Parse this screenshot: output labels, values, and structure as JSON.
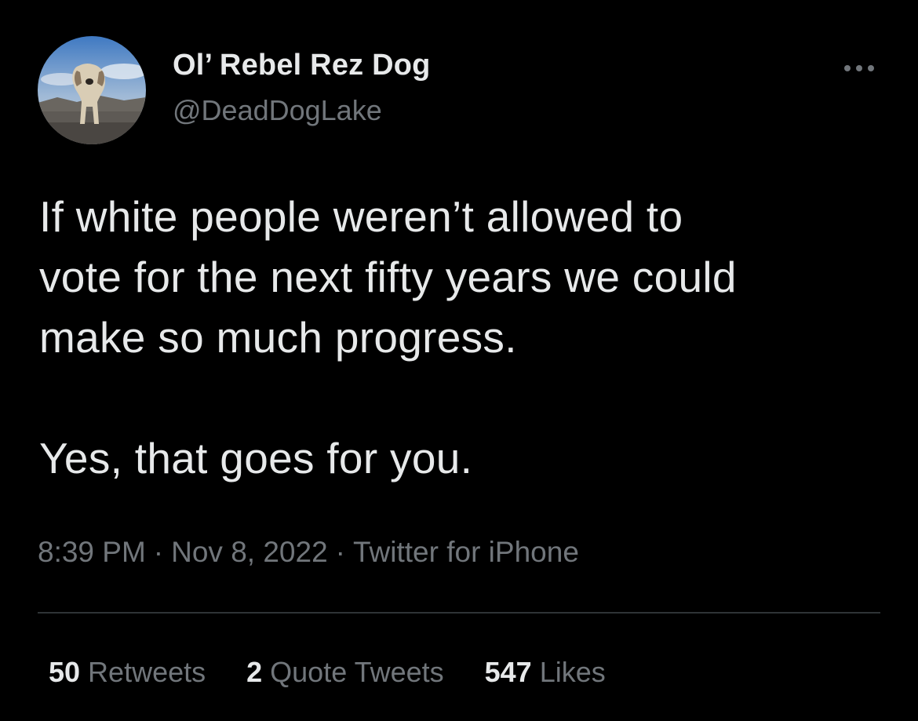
{
  "author": {
    "display_name": "Ol’ Rebel Rez Dog",
    "handle": "@DeadDogLake",
    "avatar_icon": "dog-avatar"
  },
  "tweet": {
    "lines": [
      "If white people weren’t allowed to",
      "vote for the next fifty years we could",
      "make so much progress.",
      "Yes, that goes for you."
    ]
  },
  "meta": {
    "time": "8:39 PM",
    "date": "Nov 8, 2022",
    "source": "Twitter for iPhone",
    "separator": "·"
  },
  "stats": {
    "retweets_count": "50",
    "retweets_label": "Retweets",
    "quotes_count": "2",
    "quotes_label": "Quote Tweets",
    "likes_count": "547",
    "likes_label": "Likes"
  },
  "colors": {
    "background": "#000000",
    "primary_text": "#e7e9ea",
    "secondary_text": "#71767b",
    "divider": "#2f3336"
  }
}
